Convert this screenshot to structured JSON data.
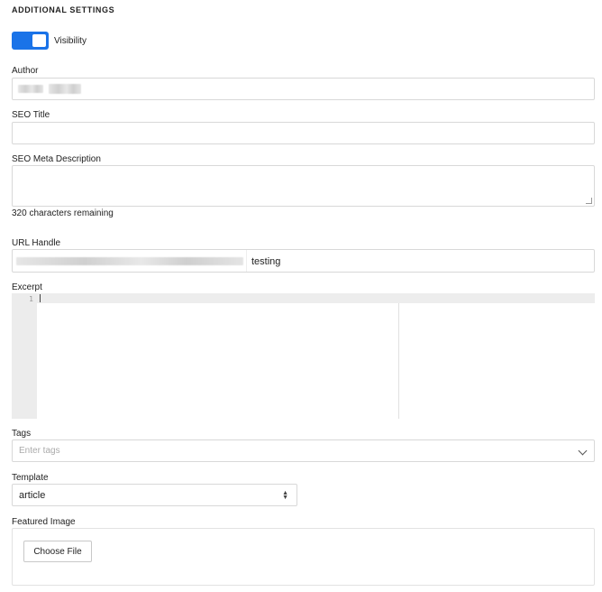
{
  "section": {
    "title": "ADDITIONAL SETTINGS"
  },
  "visibility": {
    "label": "Visibility",
    "on": true,
    "accent": "#1a73e8"
  },
  "author": {
    "label": "Author",
    "value": ""
  },
  "seo_title": {
    "label": "SEO Title",
    "value": ""
  },
  "seo_meta": {
    "label": "SEO Meta Description",
    "value": "",
    "remaining": "320 characters remaining"
  },
  "url_handle": {
    "label": "URL Handle",
    "value": "testing"
  },
  "excerpt": {
    "label": "Excerpt",
    "line_number": "1"
  },
  "tags": {
    "label": "Tags",
    "placeholder": "Enter tags"
  },
  "template": {
    "label": "Template",
    "value": "article"
  },
  "featured_image": {
    "label": "Featured Image",
    "button_label": "Choose File"
  }
}
